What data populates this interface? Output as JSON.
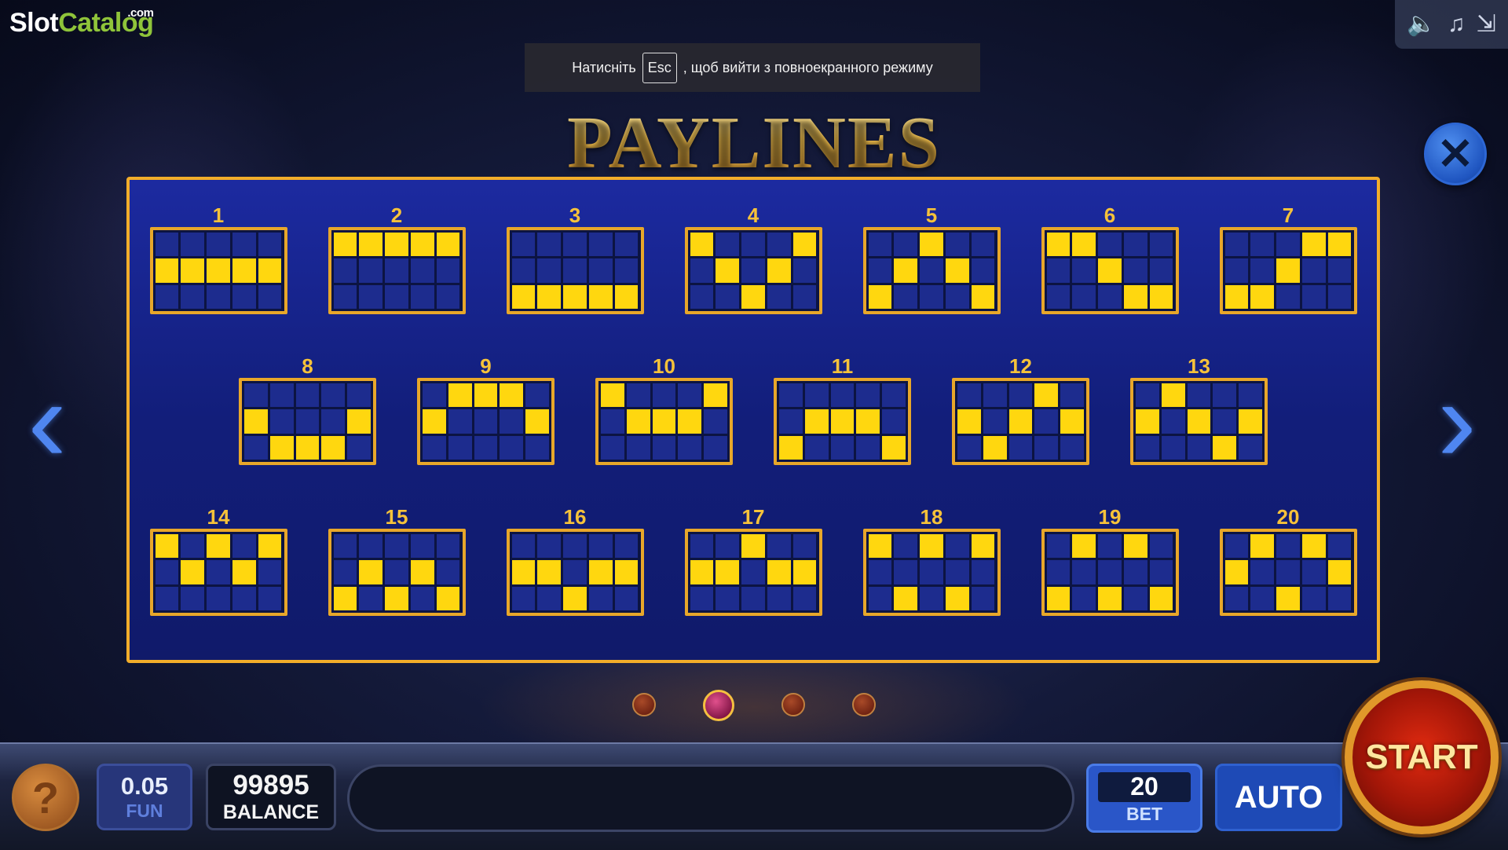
{
  "logo": {
    "slot": "Slot",
    "catalog": "Catalog",
    "com": ".com"
  },
  "notice": {
    "before": "Натисніть",
    "key": "Esc",
    "after": ", щоб вийти з повноекранного режиму"
  },
  "title": "PAYLINES",
  "top_controls": {
    "sound_icon": "speaker-icon",
    "music_icon": "music-note-icon",
    "fullscreen_icon": "exit-fullscreen-icon"
  },
  "close_icon": "close-icon",
  "paylines": [
    {
      "label": "1",
      "rows": [
        [
          0,
          0,
          0,
          0,
          0
        ],
        [
          1,
          1,
          1,
          1,
          1
        ],
        [
          0,
          0,
          0,
          0,
          0
        ]
      ]
    },
    {
      "label": "2",
      "rows": [
        [
          1,
          1,
          1,
          1,
          1
        ],
        [
          0,
          0,
          0,
          0,
          0
        ],
        [
          0,
          0,
          0,
          0,
          0
        ]
      ]
    },
    {
      "label": "3",
      "rows": [
        [
          0,
          0,
          0,
          0,
          0
        ],
        [
          0,
          0,
          0,
          0,
          0
        ],
        [
          1,
          1,
          1,
          1,
          1
        ]
      ]
    },
    {
      "label": "4",
      "rows": [
        [
          1,
          0,
          0,
          0,
          1
        ],
        [
          0,
          1,
          0,
          1,
          0
        ],
        [
          0,
          0,
          1,
          0,
          0
        ]
      ]
    },
    {
      "label": "5",
      "rows": [
        [
          0,
          0,
          1,
          0,
          0
        ],
        [
          0,
          1,
          0,
          1,
          0
        ],
        [
          1,
          0,
          0,
          0,
          1
        ]
      ]
    },
    {
      "label": "6",
      "rows": [
        [
          1,
          1,
          0,
          0,
          0
        ],
        [
          0,
          0,
          1,
          0,
          0
        ],
        [
          0,
          0,
          0,
          1,
          1
        ]
      ]
    },
    {
      "label": "7",
      "rows": [
        [
          0,
          0,
          0,
          1,
          1
        ],
        [
          0,
          0,
          1,
          0,
          0
        ],
        [
          1,
          1,
          0,
          0,
          0
        ]
      ]
    },
    {
      "label": "8",
      "rows": [
        [
          0,
          0,
          0,
          0,
          0
        ],
        [
          1,
          0,
          0,
          0,
          1
        ],
        [
          0,
          1,
          1,
          1,
          0
        ]
      ]
    },
    {
      "label": "9",
      "rows": [
        [
          0,
          1,
          1,
          1,
          0
        ],
        [
          1,
          0,
          0,
          0,
          1
        ],
        [
          0,
          0,
          0,
          0,
          0
        ]
      ]
    },
    {
      "label": "10",
      "rows": [
        [
          1,
          0,
          0,
          0,
          1
        ],
        [
          0,
          1,
          1,
          1,
          0
        ],
        [
          0,
          0,
          0,
          0,
          0
        ]
      ]
    },
    {
      "label": "11",
      "rows": [
        [
          0,
          0,
          0,
          0,
          0
        ],
        [
          0,
          1,
          1,
          1,
          0
        ],
        [
          1,
          0,
          0,
          0,
          1
        ]
      ]
    },
    {
      "label": "12",
      "rows": [
        [
          0,
          0,
          0,
          1,
          0
        ],
        [
          1,
          0,
          1,
          0,
          1
        ],
        [
          0,
          1,
          0,
          0,
          0
        ]
      ]
    },
    {
      "label": "13",
      "rows": [
        [
          0,
          1,
          0,
          0,
          0
        ],
        [
          1,
          0,
          1,
          0,
          1
        ],
        [
          0,
          0,
          0,
          1,
          0
        ]
      ]
    },
    {
      "label": "14",
      "rows": [
        [
          1,
          0,
          1,
          0,
          1
        ],
        [
          0,
          1,
          0,
          1,
          0
        ],
        [
          0,
          0,
          0,
          0,
          0
        ]
      ]
    },
    {
      "label": "15",
      "rows": [
        [
          0,
          0,
          0,
          0,
          0
        ],
        [
          0,
          1,
          0,
          1,
          0
        ],
        [
          1,
          0,
          1,
          0,
          1
        ]
      ]
    },
    {
      "label": "16",
      "rows": [
        [
          0,
          0,
          0,
          0,
          0
        ],
        [
          1,
          1,
          0,
          1,
          1
        ],
        [
          0,
          0,
          1,
          0,
          0
        ]
      ]
    },
    {
      "label": "17",
      "rows": [
        [
          0,
          0,
          1,
          0,
          0
        ],
        [
          1,
          1,
          0,
          1,
          1
        ],
        [
          0,
          0,
          0,
          0,
          0
        ]
      ]
    },
    {
      "label": "18",
      "rows": [
        [
          1,
          0,
          1,
          0,
          1
        ],
        [
          0,
          0,
          0,
          0,
          0
        ],
        [
          0,
          1,
          0,
          1,
          0
        ]
      ]
    },
    {
      "label": "19",
      "rows": [
        [
          0,
          1,
          0,
          1,
          0
        ],
        [
          0,
          0,
          0,
          0,
          0
        ],
        [
          1,
          0,
          1,
          0,
          1
        ]
      ]
    },
    {
      "label": "20",
      "rows": [
        [
          0,
          1,
          0,
          1,
          0
        ],
        [
          1,
          0,
          0,
          0,
          1
        ],
        [
          0,
          0,
          1,
          0,
          0
        ]
      ]
    }
  ],
  "nav": {
    "prev_icon": "chevron-left-icon",
    "next_icon": "chevron-right-icon"
  },
  "pages": {
    "total": 4,
    "active_index": 1
  },
  "bottom": {
    "help_label": "?",
    "coin_value": "0.05",
    "coin_label": "FUN",
    "balance_value": "99895",
    "balance_label": "BALANCE",
    "message": "",
    "bet_value": "20",
    "bet_label": "BET",
    "auto_label": "AUTO",
    "start_label": "START"
  },
  "colors": {
    "panel_border": "#f2ad2a",
    "cell_on": "#ffd70f",
    "cell_off": "#1d2c8e",
    "title_gold": "#f2c35a"
  }
}
